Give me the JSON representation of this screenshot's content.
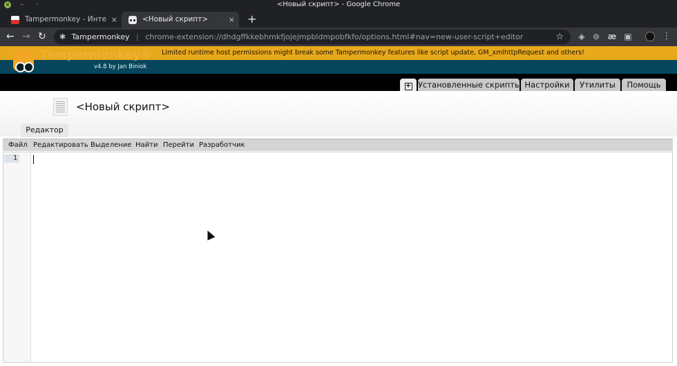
{
  "window": {
    "title": "<Новый скрипт> - Google Chrome",
    "close_glyph": "×",
    "min_glyph": "–",
    "max_glyph": "◦"
  },
  "tabs": [
    {
      "label": "Tampermonkey - Интернет-м",
      "active": false,
      "close": "×"
    },
    {
      "label": "<Новый скрипт>",
      "active": true,
      "close": "×"
    }
  ],
  "new_tab_glyph": "+",
  "toolbar": {
    "back_glyph": "←",
    "forward_glyph": "→",
    "reload_glyph": "↻",
    "ext_glyph": "✱",
    "omnibox_name": "Tampermonkey",
    "omnibox_sep": "|",
    "omnibox_url": "chrome-extension://dhdgffkkebhmkfjojejmpbldmpobfkfo/options.html#nav=new-user-script+editor",
    "star_glyph": "☆",
    "ext_icons": [
      "shield-icon",
      "extension-icon",
      "ae-icon",
      "puzzle-icon",
      "avatar"
    ],
    "ext_glyphs": [
      "◈",
      "⊚",
      "æ",
      "▣"
    ],
    "menu_glyph": "⋮"
  },
  "tm": {
    "warning": "Limited runtime host permissions might break some Tampermonkey features like script update, GM_xmlhttpRequest and others!",
    "brand": "Tampermonkey®",
    "version": "v4.8 by Jan Biniok",
    "colors": {
      "header": "#06465c",
      "warning": "#e8a91c",
      "logo": "#f3a526"
    }
  },
  "nav": {
    "new_script_glyph": "+",
    "installed": "Установленные скрипты",
    "settings": "Настройки",
    "utils": "Утилиты",
    "help": "Помощь"
  },
  "script": {
    "title": "<Новый скрипт>",
    "editor_tab": "Редактор"
  },
  "menu": {
    "file": "Файл",
    "edit": "Редактировать",
    "selection": "Выделение",
    "find": "Найти",
    "goto": "Перейти",
    "developer": "Разработчик"
  },
  "editor": {
    "line_numbers": [
      "1"
    ],
    "content": ""
  }
}
